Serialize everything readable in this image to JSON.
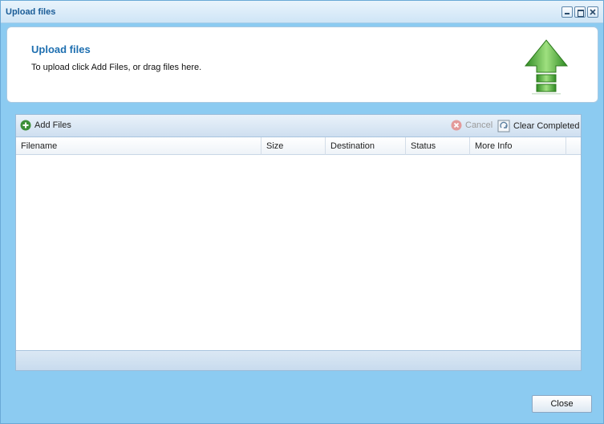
{
  "window": {
    "title": "Upload files"
  },
  "header": {
    "title": "Upload files",
    "description": "To upload click Add Files, or drag files here."
  },
  "toolbar": {
    "add_label": "Add Files",
    "cancel_label": "Cancel",
    "clear_label": "Clear Completed"
  },
  "columns": [
    "Filename",
    "Size",
    "Destination",
    "Status",
    "More Info"
  ],
  "footer": {
    "close_label": "Close"
  },
  "colors": {
    "accent": "#1e6fb0",
    "window_bg": "#8ccbf1",
    "upload_arrow": "#4caf38"
  },
  "icons": {
    "add": "plus-circle-icon",
    "cancel": "x-circle-icon",
    "clear": "recycle-icon",
    "header": "upload-arrow-icon"
  }
}
